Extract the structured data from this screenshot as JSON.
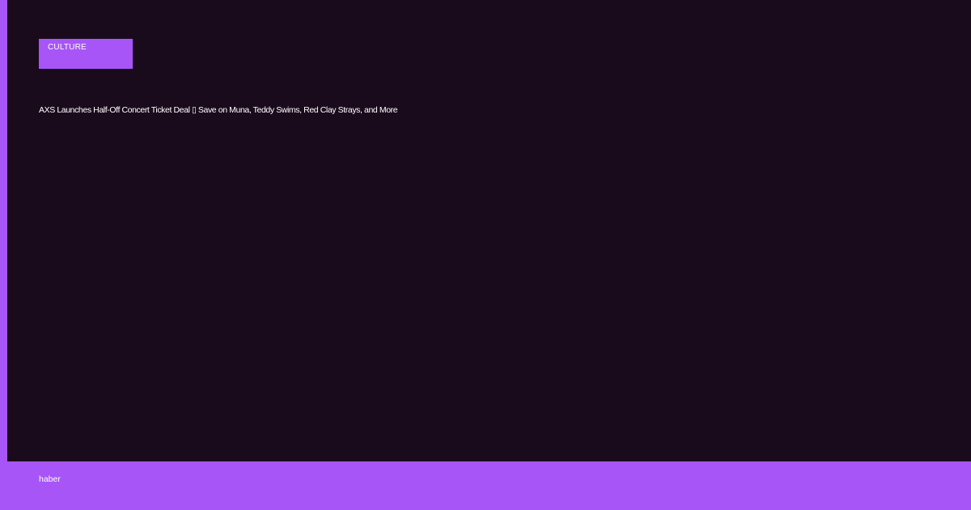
{
  "colors": {
    "accent": "#a855f7",
    "panel_background": "#1a0b1c",
    "text": "#ffffff"
  },
  "article": {
    "category": "CULTURE",
    "headline": "AXS Launches Half-Off Concert Ticket Deal ▯ Save on Muna, Teddy Swims, Red Clay Strays, and More"
  },
  "footer": {
    "brand": "haber"
  }
}
